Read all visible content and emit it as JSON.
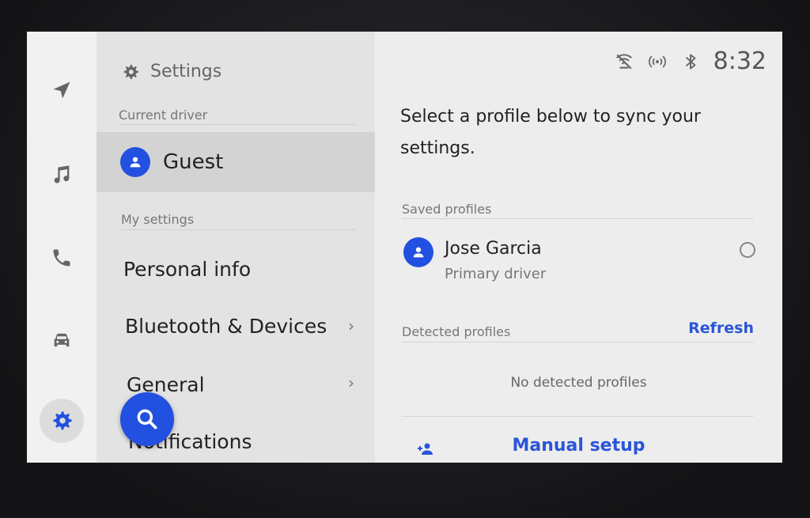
{
  "rail": {
    "items": [
      {
        "icon": "navigation-icon"
      },
      {
        "icon": "music-icon"
      },
      {
        "icon": "phone-icon"
      },
      {
        "icon": "car-icon"
      },
      {
        "icon": "gear-icon",
        "active": true
      }
    ]
  },
  "panel": {
    "title": "Settings",
    "current_driver_label": "Current driver",
    "current_driver_name": "Guest",
    "my_settings_label": "My settings",
    "menu": [
      {
        "label": "Personal info",
        "chevron": false
      },
      {
        "label": "Bluetooth & Devices",
        "chevron": true
      },
      {
        "label": "General",
        "chevron": true
      },
      {
        "label": "Notifications",
        "chevron": false
      }
    ]
  },
  "status_bar": {
    "time": "8:32",
    "icons": [
      "no-connection-icon",
      "wireless-signal-icon",
      "bluetooth-icon"
    ]
  },
  "main": {
    "prompt": "Select a profile below to sync your settings.",
    "saved_profiles_label": "Saved profiles",
    "profiles": [
      {
        "name": "Jose Garcia",
        "subtitle": "Primary driver",
        "selected": false
      }
    ],
    "detected_profiles_label": "Detected profiles",
    "refresh_label": "Refresh",
    "no_detected_text": "No detected profiles",
    "manual_setup_label": "Manual setup"
  },
  "colors": {
    "accent": "#2250e0",
    "link": "#2a55d8"
  }
}
